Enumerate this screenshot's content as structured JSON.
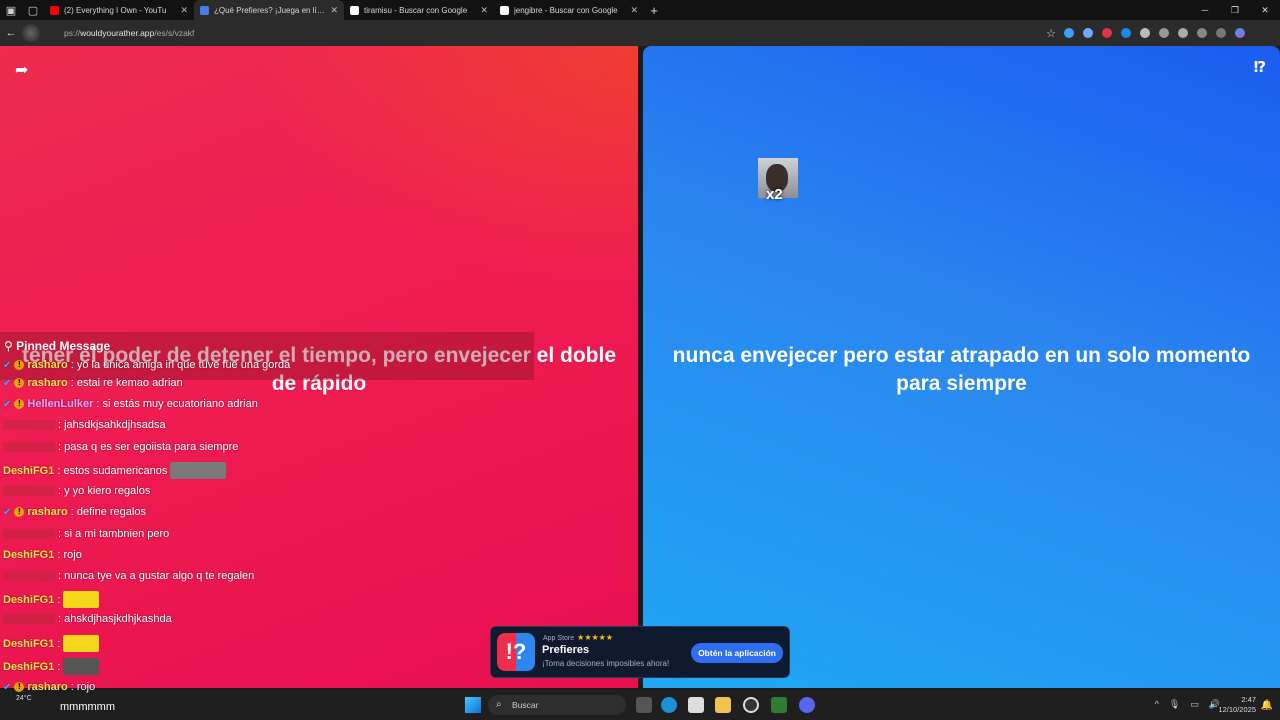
{
  "tabs": [
    {
      "title": "(2) Everything I Own - YouTu",
      "favicon_color": "#ff0000",
      "active": false
    },
    {
      "title": "¿Qué Prefieres? ¡Juega en línea!",
      "favicon_color": "#4a7cf0",
      "active": true
    },
    {
      "title": "tiramisu - Buscar con Google",
      "favicon_color": "#ffffff",
      "active": false
    },
    {
      "title": "jengibre - Buscar con Google",
      "favicon_color": "#ffffff",
      "active": false
    }
  ],
  "address": {
    "prefix": "ps://",
    "host": "wouldyourather.app",
    "path": "/es/s/vzakf"
  },
  "game": {
    "option_red": "tener el poder de detener el tiempo, pero envejecer el doble de rápido",
    "option_blue": "nunca envejecer pero estar atrapado en un solo momento para siempre",
    "voter_count": "x2"
  },
  "chat": {
    "pinned_title": "Pinned Message",
    "lines": [
      {
        "user": "rasharo",
        "text": ": yo la unica amiga irl que tuve fue una gorda",
        "badges": true,
        "dim": false,
        "user_color": "#ffe24a"
      },
      {
        "user": "rasharo",
        "text": ": estai re kemao adrian",
        "badges": true,
        "dim": false,
        "user_color": "#ffe24a"
      },
      {
        "user": "HellenLulker",
        "text": ": si estás muy ecuatoriano adrian",
        "badges": true,
        "dim": false,
        "user_color": "#e7a6ff"
      },
      {
        "user": "",
        "text": ": jahsdkjsahkdjhsadsa",
        "badges": false,
        "dim": true,
        "user_color": "#c43a4d"
      },
      {
        "user": "",
        "text": ": pasa q es ser egoiista para siempre",
        "badges": false,
        "dim": true,
        "user_color": "#c43a4d"
      },
      {
        "user": "DeshiFG1",
        "text": ": estos sudamericanos",
        "badges": false,
        "dim": false,
        "user_color": "#ffe24a"
      },
      {
        "user": "",
        "text": ": y yo kiero regalos",
        "badges": false,
        "dim": true,
        "user_color": "#c43a4d"
      },
      {
        "user": "rasharo",
        "text": ": define regalos",
        "badges": true,
        "dim": false,
        "user_color": "#ffe24a"
      },
      {
        "user": "",
        "text": ": si a mi tambnien pero",
        "badges": false,
        "dim": true,
        "user_color": "#c43a4d"
      },
      {
        "user": "DeshiFG1",
        "text": ": rojo",
        "badges": false,
        "dim": false,
        "user_color": "#ffe24a"
      },
      {
        "user": "",
        "text": ": nunca tye va a gustar algo q te regalen",
        "badges": false,
        "dim": true,
        "user_color": "#c43a4d"
      },
      {
        "user": "DeshiFG1",
        "text": ":",
        "badges": false,
        "dim": false,
        "user_color": "#ffe24a"
      },
      {
        "user": "",
        "text": ": ahskdjhasjkdhjkashda",
        "badges": false,
        "dim": true,
        "user_color": "#c43a4d"
      },
      {
        "user": "DeshiFG1",
        "text": ":",
        "badges": false,
        "dim": false,
        "user_color": "#ffe24a"
      },
      {
        "user": "DeshiFG1",
        "text": ":",
        "badges": false,
        "dim": false,
        "user_color": "#ffe24a"
      },
      {
        "user": "rasharo",
        "text": ": rojo",
        "badges": true,
        "dim": false,
        "user_color": "#ffe24a"
      }
    ]
  },
  "app_banner": {
    "store": "App Store",
    "stars": "★★★★★",
    "name": "Prefieres",
    "tagline": "¡Toma decisiones imposibles ahora!",
    "button": "Obtén la aplicación"
  },
  "taskbar": {
    "weather": "24°C",
    "caption": "mmmmmm",
    "search_placeholder": "Buscar",
    "time": "2:47",
    "date": "12/10/2025"
  }
}
